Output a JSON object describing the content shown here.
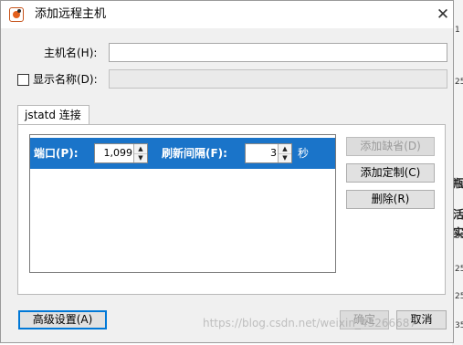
{
  "dialog": {
    "title": "添加远程主机",
    "close_glyph": "✕"
  },
  "form": {
    "host_label": "主机名(H):",
    "host_value": "",
    "display_label": "显示名称(D):",
    "display_checked": false,
    "display_value": ""
  },
  "tabs": [
    {
      "label": "jstatd 连接"
    }
  ],
  "jstatd": {
    "port_label": "端口(P):",
    "port_value": "1,099",
    "refresh_label": "刷新间隔(F):",
    "refresh_value": "3",
    "refresh_unit": "秒"
  },
  "side_buttons": {
    "add_default": "添加缺省(D)",
    "add_custom": "添加定制(C)",
    "delete": "删除(R)"
  },
  "footer": {
    "advanced": "高级设置(A)",
    "ok": "确定",
    "cancel": "取消"
  },
  "watermark": "https://blog.csdn.net/weixin_43266687",
  "background": {
    "fragments": [
      "瓶",
      "活",
      "实"
    ],
    "numbers": [
      "1",
      "25",
      "35",
      "25",
      "25",
      "35"
    ]
  }
}
